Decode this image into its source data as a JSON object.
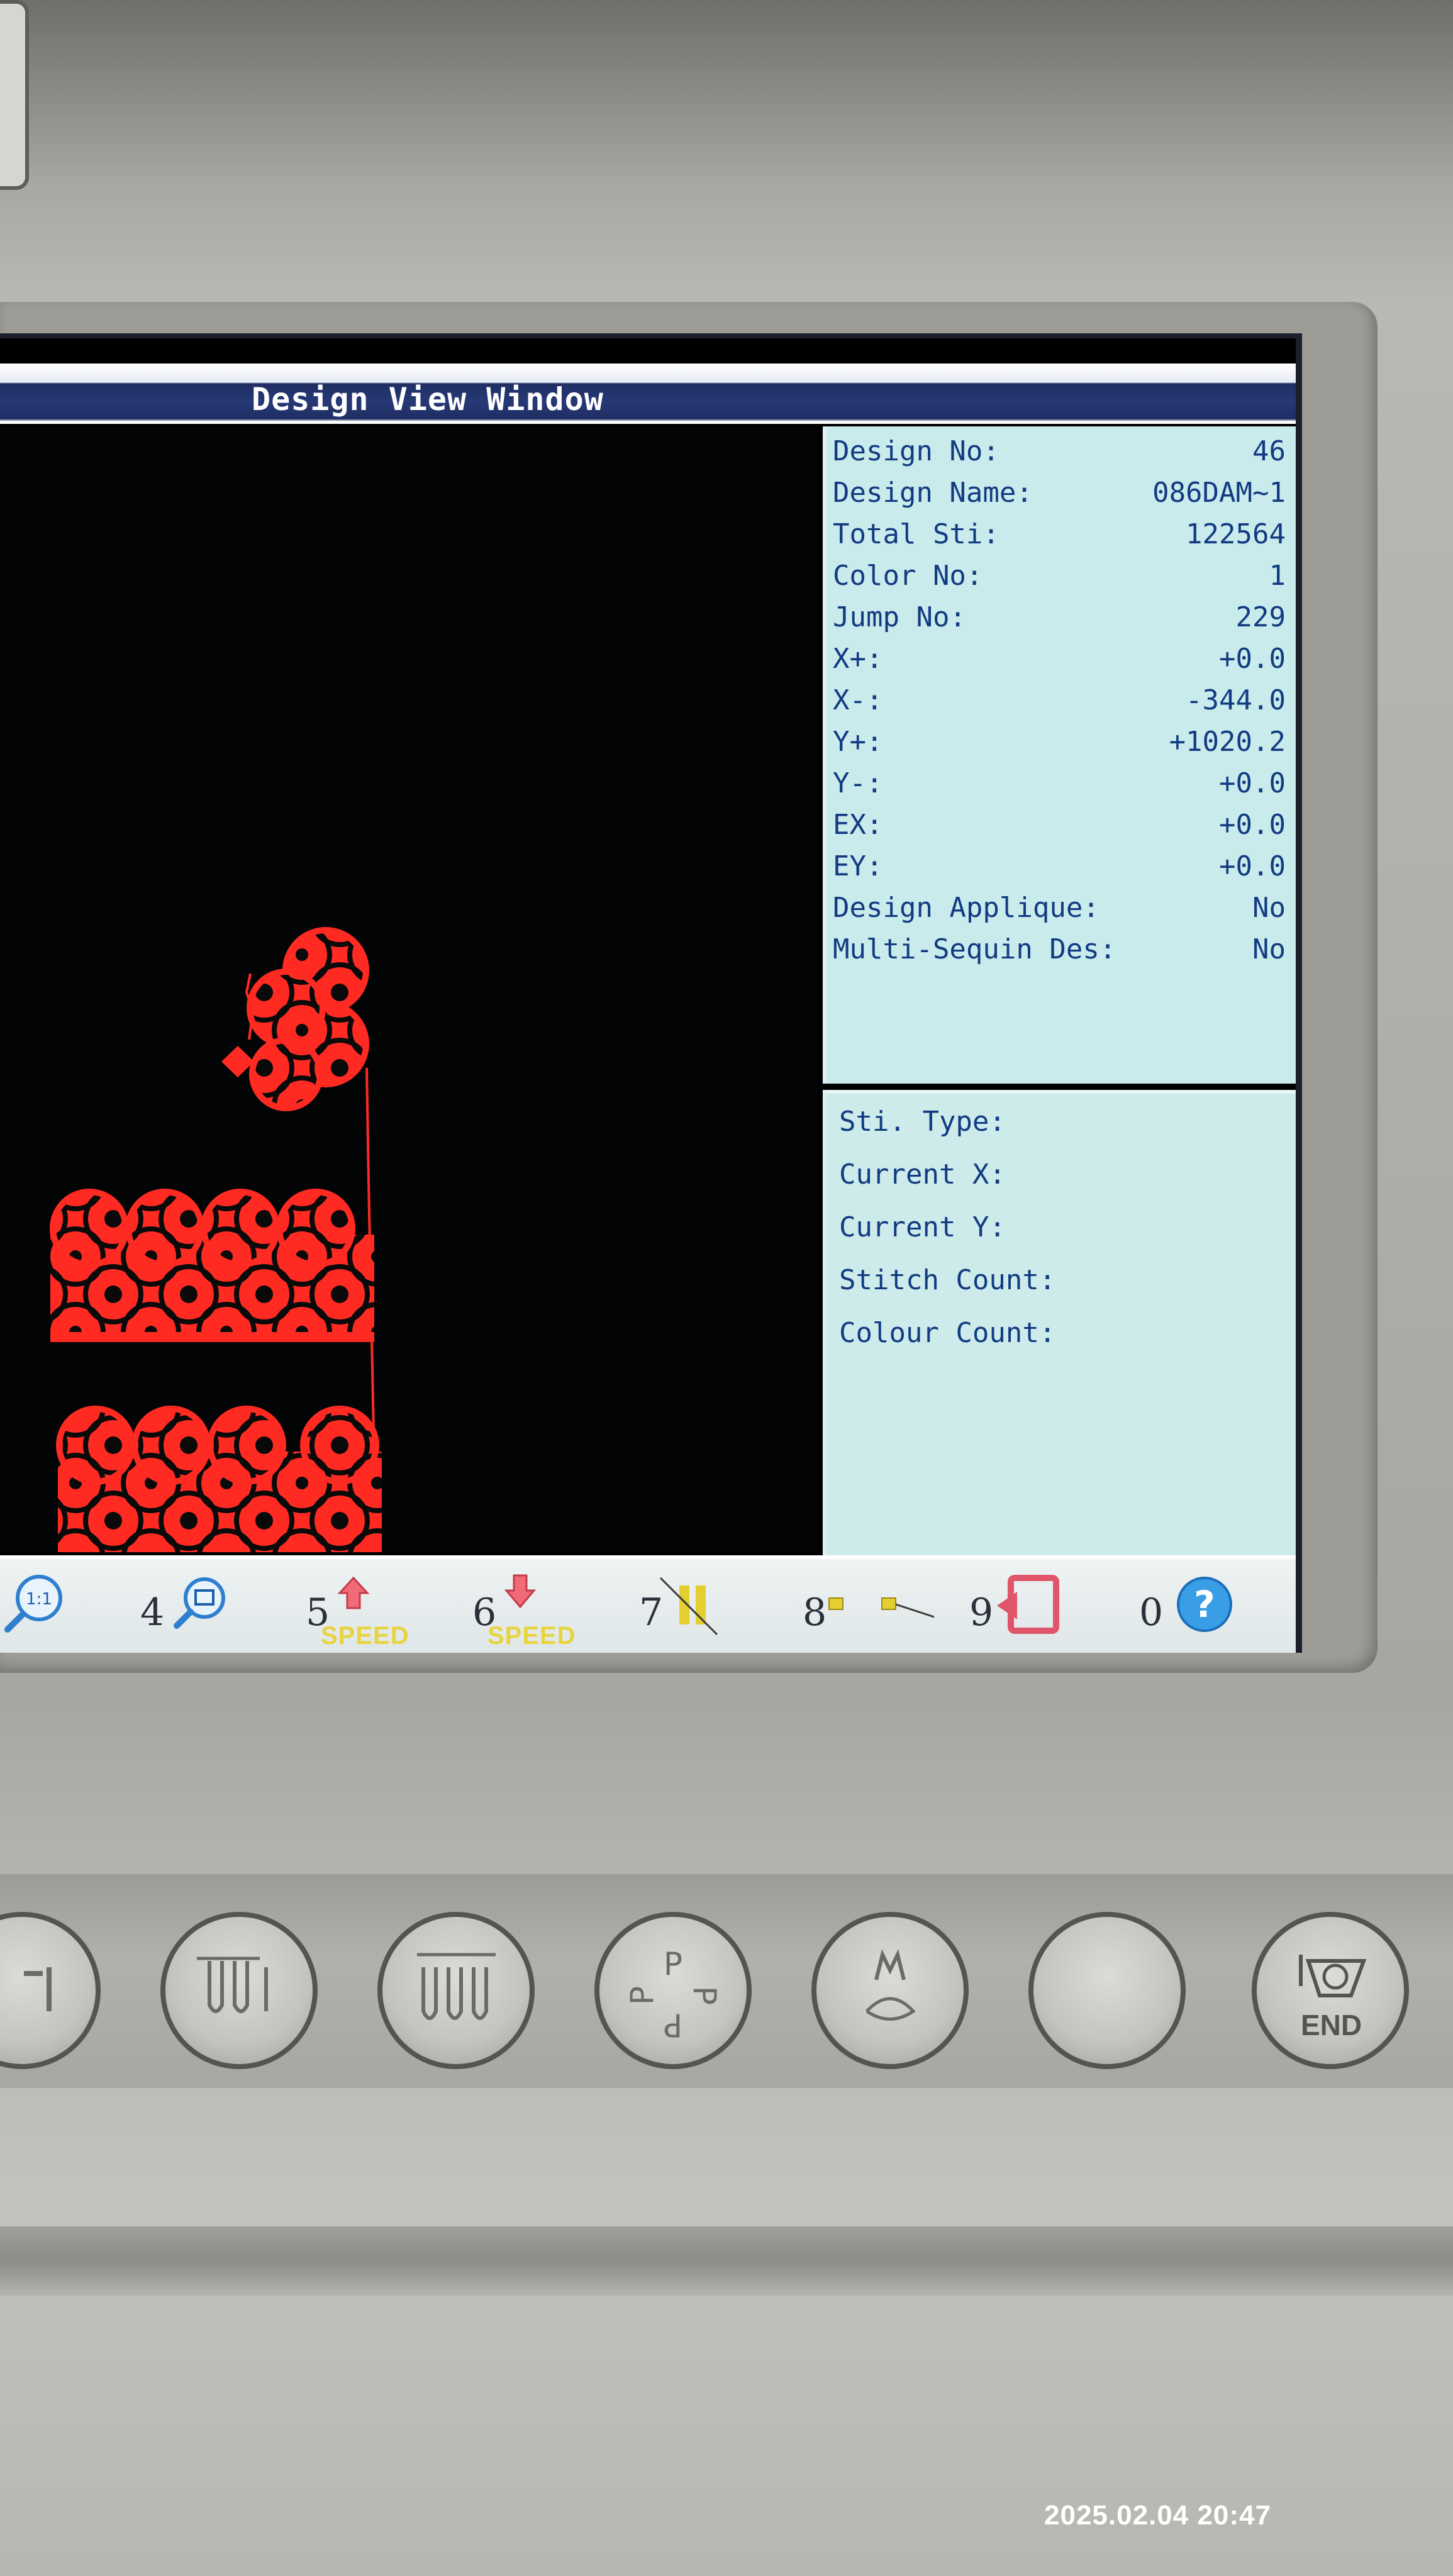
{
  "window": {
    "title": "Design View Window"
  },
  "design_info": {
    "rows": [
      {
        "label": "Design No:",
        "value": "46"
      },
      {
        "label": "Design Name:",
        "value": "086DAM~1"
      },
      {
        "label": "Total Sti:",
        "value": "122564"
      },
      {
        "label": "Color No:",
        "value": "1"
      },
      {
        "label": "Jump No:",
        "value": "229"
      },
      {
        "label": "X+:",
        "value": "+0.0"
      },
      {
        "label": "X-:",
        "value": "-344.0"
      },
      {
        "label": "Y+:",
        "value": "+1020.2"
      },
      {
        "label": "Y-:",
        "value": "+0.0"
      },
      {
        "label": "EX:",
        "value": "+0.0"
      },
      {
        "label": "EY:",
        "value": "+0.0"
      },
      {
        "label": "Design Applique:",
        "value": "No"
      },
      {
        "label": "Multi-Sequin Des:",
        "value": "No"
      }
    ]
  },
  "stitch_status": {
    "labels": [
      "Sti. Type:",
      "Current X:",
      "Current Y:",
      "Stitch Count:",
      "Colour Count:"
    ]
  },
  "function_keys": [
    {
      "num": "",
      "icon": "zoom-1to1-icon"
    },
    {
      "num": "4",
      "icon": "zoom-fit-icon"
    },
    {
      "num": "5",
      "icon": "arrow-up-icon",
      "caption": "SPEED"
    },
    {
      "num": "6",
      "icon": "arrow-down-icon",
      "caption": "SPEED"
    },
    {
      "num": "7",
      "icon": "pause-icon"
    },
    {
      "num": "8",
      "icon": "frame-move-icon"
    },
    {
      "num": "9",
      "icon": "return-icon"
    },
    {
      "num": "0",
      "icon": "help-icon"
    }
  ],
  "hardware_buttons": [
    {
      "icon": "arrow-left-icon"
    },
    {
      "icon": "needle-select-icon"
    },
    {
      "icon": "three-needles-icon"
    },
    {
      "icon": "p-rotation-icon"
    },
    {
      "icon": "menu-m-icon"
    },
    {
      "icon": "blank-icon"
    },
    {
      "icon": "end-icon",
      "label": "END"
    }
  ],
  "colors": {
    "embroidery": "#ff2a22",
    "panel_text": "#123b82",
    "panel_bg": "#c9ebec",
    "title_bar": "#263975"
  },
  "timestamp": "2025.02.04 20:47"
}
